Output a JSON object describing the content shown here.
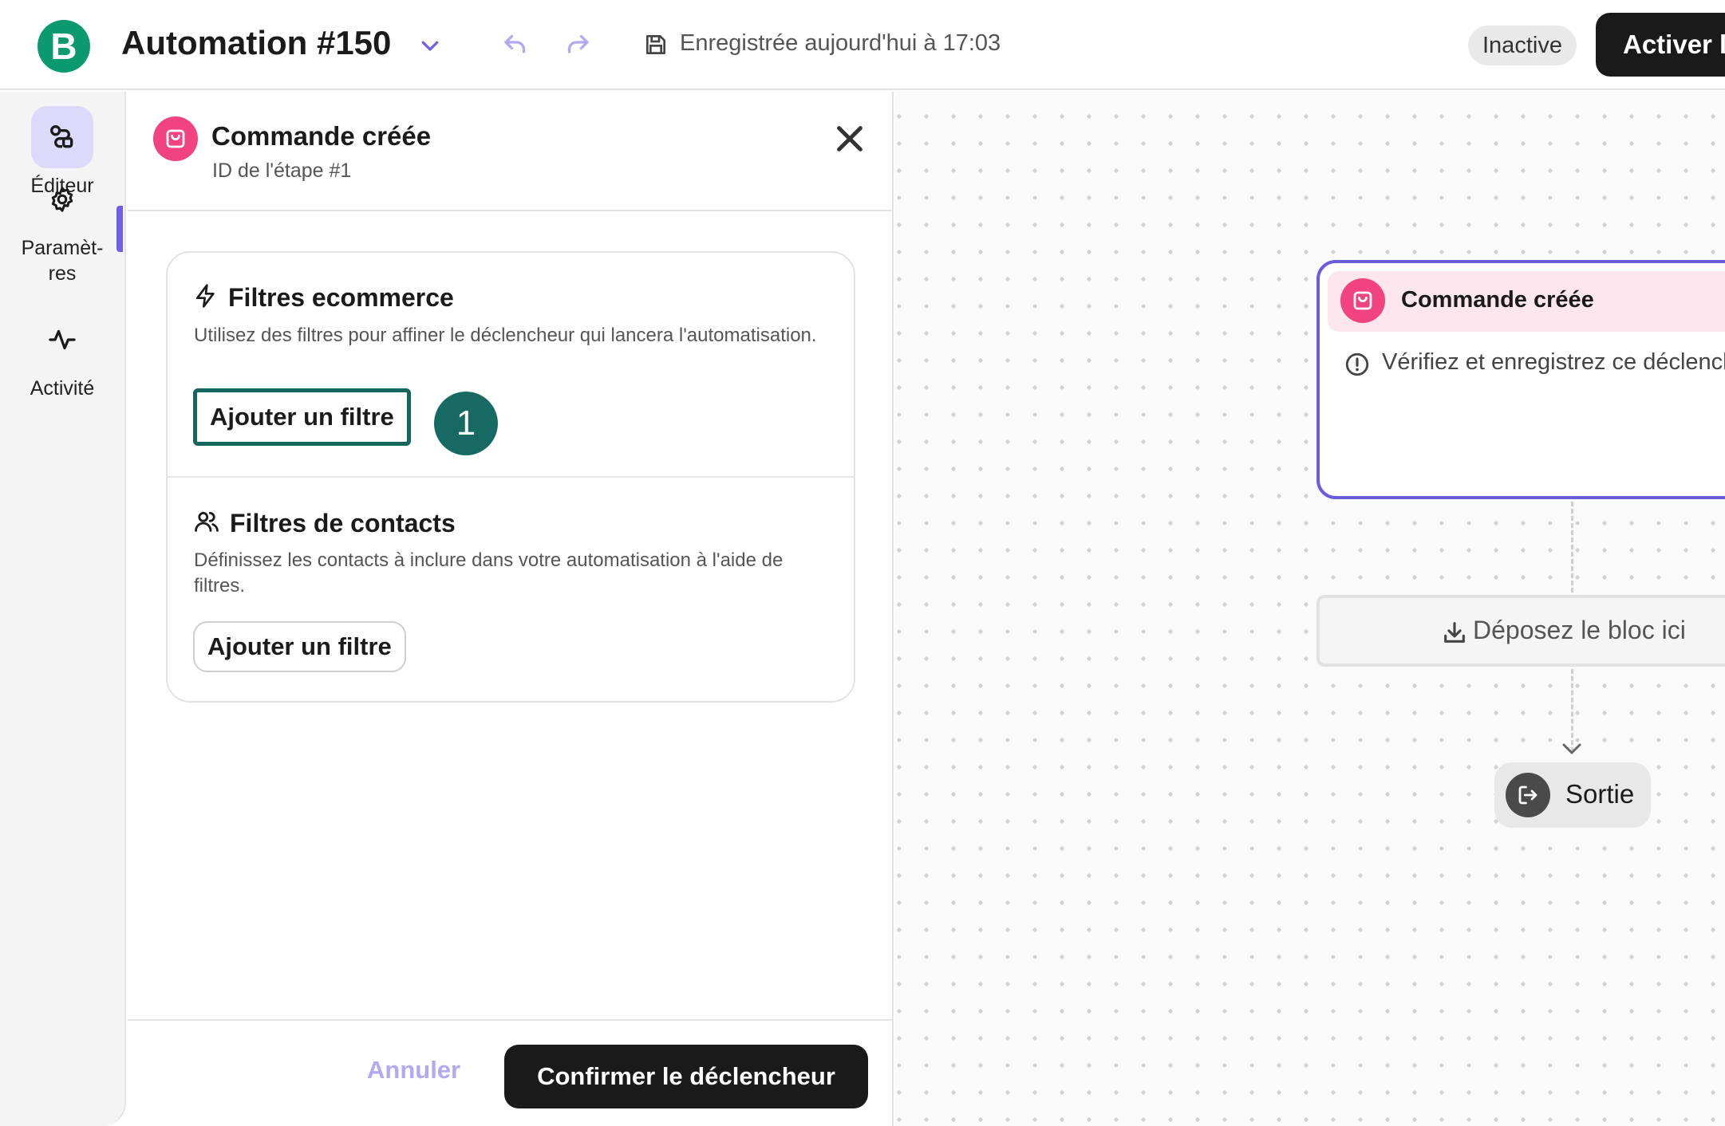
{
  "topbar": {
    "logo_letter": "B",
    "title": "Automation #150",
    "save_status": "Enregistrée aujourd'hui à 17:03",
    "status_badge": "Inactive",
    "activate_label": "Activer l'automatisation",
    "icons": [
      "chevron-down-icon",
      "undo-icon",
      "redo-icon",
      "save-icon"
    ]
  },
  "rail": {
    "items": [
      {
        "label": "Éditeur",
        "icon": "editor-icon",
        "active": true
      },
      {
        "label": "Paramèt-\nres",
        "icon": "gear-icon",
        "active": false
      },
      {
        "label": "Activité",
        "icon": "activity-icon",
        "active": false
      }
    ],
    "accent_color": "#6f5fe6"
  },
  "panel": {
    "title": "Commande créée",
    "subtitle": "ID de l'étape #1",
    "icon": "shopping-bag-icon",
    "sections": {
      "ecommerce": {
        "title": "Filtres ecommerce",
        "icon": "lightning-icon",
        "description": "Utilisez des filtres pour affiner le déclencheur qui lancera l'automatisation.",
        "button": "Ajouter un filtre",
        "step_badge": "1"
      },
      "contacts": {
        "title": "Filtres de contacts",
        "icon": "contacts-icon",
        "description": "Définissez les contacts à inclure dans votre automatisation à l'aide de filtres.",
        "button": "Ajouter un filtre"
      }
    },
    "footer": {
      "cancel": "Annuler",
      "confirm": "Confirmer le déclencheur"
    }
  },
  "canvas": {
    "trigger_node": {
      "title": "Commande créée",
      "warning": "Vérifiez et enregistrez ce déclencheur",
      "border_color": "#6b5be0"
    },
    "drop_zone": "Déposez le bloc ici",
    "exit_label": "Sortie"
  },
  "colors": {
    "brand_green": "#0b996e",
    "trigger_pink": "#f0437f",
    "focus_teal": "#14665f"
  }
}
